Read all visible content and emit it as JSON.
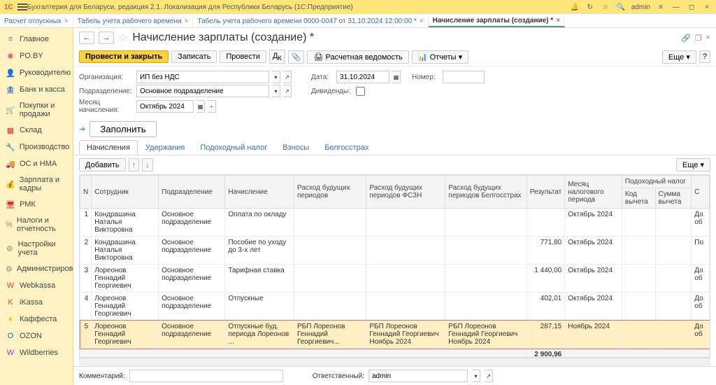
{
  "window": {
    "logo_text": "1C",
    "title": "Бухгалтерия для Беларуси, редакция 2.1. Локализация для Республики Беларусь  (1С:Предприятие)",
    "user": "admin"
  },
  "doc_tabs": [
    {
      "label": "Расчет отпускных",
      "active": false
    },
    {
      "label": "Табель учета рабочего времени",
      "active": false
    },
    {
      "label": "Табель учета рабочего времени 0000-0047 от 31.10.2024 12:00:00 *",
      "active": false
    },
    {
      "label": "Начисление зарплаты (создание) *",
      "active": true
    }
  ],
  "sidebar": [
    {
      "icon": "≡",
      "label": "Главное",
      "color": "#777"
    },
    {
      "icon": "✱",
      "label": "PO.BY",
      "color": "#e57"
    },
    {
      "icon": "👤",
      "label": "Руководителю",
      "color": "#e57"
    },
    {
      "icon": "🏦",
      "label": "Банк и касса",
      "color": "#d44"
    },
    {
      "icon": "🛒",
      "label": "Покупки и продажи",
      "color": "#c33"
    },
    {
      "icon": "▦",
      "label": "Склад",
      "color": "#c33"
    },
    {
      "icon": "🔧",
      "label": "Производство",
      "color": "#888"
    },
    {
      "icon": "🚚",
      "label": "ОС и НМА",
      "color": "#888"
    },
    {
      "icon": "💰",
      "label": "Зарплата и кадры",
      "color": "#c80"
    },
    {
      "icon": "🖥",
      "label": "РМК",
      "color": "#c33"
    },
    {
      "icon": "%",
      "label": "Налоги и отчетность",
      "color": "#888"
    },
    {
      "icon": "⚙",
      "label": "Настройки учета",
      "color": "#888"
    },
    {
      "icon": "⚙",
      "label": "Администрирование",
      "color": "#888"
    },
    {
      "icon": "W",
      "label": "Webkassa",
      "color": "#d44"
    },
    {
      "icon": "K",
      "label": "iKassa",
      "color": "#d44"
    },
    {
      "icon": "●",
      "label": "Каффеста",
      "color": "#fc0"
    },
    {
      "icon": "O",
      "label": "OZON",
      "color": "#06c"
    },
    {
      "icon": "W",
      "label": "Wildberries",
      "color": "#a3c"
    }
  ],
  "page": {
    "title": "Начисление зарплаты (создание) *",
    "nav_back": "←",
    "nav_fwd": "→",
    "hdr_actions": {
      "link": "🔗",
      "win": "❐",
      "close": "×"
    }
  },
  "toolbar": {
    "primary": "Провести и закрыть",
    "write": "Записать",
    "post": "Провести",
    "sheet": "Расчетная ведомость",
    "reports": "Отчеты",
    "more": "Еще"
  },
  "form": {
    "org_label": "Организация:",
    "org_value": "ИП без НДС",
    "date_label": "Дата:",
    "date_value": "31.10.2024",
    "num_label": "Номер:",
    "num_value": "",
    "dept_label": "Подразделение:",
    "dept_value": "Основное подразделение",
    "div_label": "Дивиденды:",
    "month_label": "Месяц начисления:",
    "month_value": "Октябрь 2024",
    "fill_btn": "Заполнить"
  },
  "subtabs": [
    "Начисления",
    "Удержания",
    "Подоходный налог",
    "Взносы",
    "Белгосстрах"
  ],
  "tbl_toolbar": {
    "add": "Добавить",
    "up": "↑",
    "down": "↓",
    "more": "Еще"
  },
  "columns": [
    "N",
    "Сотрудник",
    "Подразделение",
    "Начисление",
    "Расход будущих периодов",
    "Расход будущих периодов ФСЗН",
    "Расход будущих периодов Белгосстрах",
    "Результат",
    "Месяц налогового периода",
    "Подоходный налог",
    "С"
  ],
  "sub_cols": {
    "kod": "Код вычета",
    "sum": "Сумма вычета"
  },
  "rows": [
    {
      "n": "1",
      "emp": "Кондрашина Наталья Викторовна",
      "dept": "Основное подразделение",
      "nach": "Оплата по окладу",
      "rbp": "",
      "rbp_f": "",
      "rbp_b": "",
      "res": "",
      "period": "Октябрь 2024",
      "tail": "До об"
    },
    {
      "n": "2",
      "emp": "Кондрашина Наталья Викторовна",
      "dept": "Основное подразделение",
      "nach": "Пособие по уходу до 3-х лет",
      "rbp": "",
      "rbp_f": "",
      "rbp_b": "",
      "res": "771,80",
      "period": "Октябрь 2024",
      "tail": "По"
    },
    {
      "n": "3",
      "emp": "Лореонов Геннадий Георгиевич",
      "dept": "Основное подразделение",
      "nach": "Тарифная ставка",
      "rbp": "",
      "rbp_f": "",
      "rbp_b": "",
      "res": "1 440,00",
      "period": "Октябрь 2024",
      "tail": "До об"
    },
    {
      "n": "4",
      "emp": "Лореонов Геннадий Георгиевич",
      "dept": "Основное подразделение",
      "nach": "Отпускные",
      "rbp": "",
      "rbp_f": "",
      "rbp_b": "",
      "res": "402,01",
      "period": "Октябрь 2024",
      "tail": "До об"
    },
    {
      "n": "5",
      "emp": "Лореонов Геннадий Георгиевич",
      "dept": "Основное подразделение",
      "nach": "Отпускные буд. периода Лореонов ...",
      "rbp": "РБП Лореонов Геннадий Георгиевич...",
      "rbp_f": "РБП Лореонов Геннадий Георгиевич Ноябрь 2024",
      "rbp_b": "РБП Лореонов Геннадий Георгиевич Ноябрь 2024",
      "res": "287,15",
      "period": "Ноябрь 2024",
      "tail": "До об",
      "hl": true
    }
  ],
  "total": "2 900,96",
  "footer": {
    "comment_label": "Комментарий:",
    "comment_value": "",
    "resp_label": "Ответственный:",
    "resp_value": "admin"
  }
}
